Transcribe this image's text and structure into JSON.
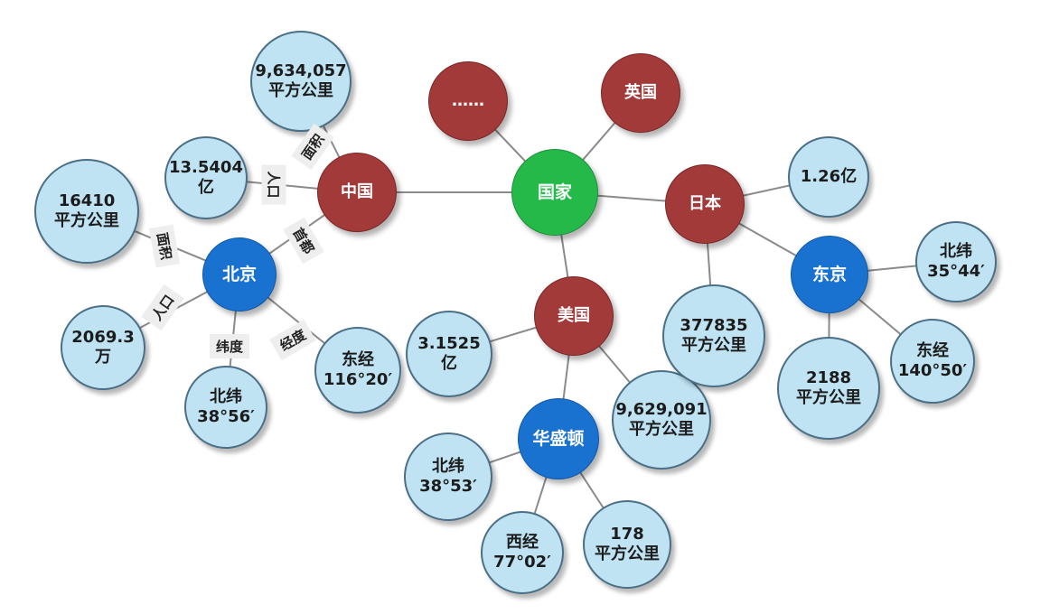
{
  "nodes": {
    "root": {
      "label": "国家",
      "type": "root"
    },
    "more": {
      "label": "……",
      "type": "country"
    },
    "uk": {
      "label": "英国",
      "type": "country"
    },
    "china": {
      "label": "中国",
      "type": "country"
    },
    "japan": {
      "label": "日本",
      "type": "country"
    },
    "usa": {
      "label": "美国",
      "type": "country"
    },
    "beijing": {
      "label": "北京",
      "type": "city"
    },
    "tokyo": {
      "label": "东京",
      "type": "city"
    },
    "washington": {
      "label": "华盛顿",
      "type": "city"
    },
    "china_area": {
      "lines": [
        "9,634,057",
        "平方公里"
      ],
      "type": "info"
    },
    "china_pop": {
      "lines": [
        "13.5404",
        "亿"
      ],
      "type": "info"
    },
    "beijing_area": {
      "lines": [
        "16410",
        "平方公里"
      ],
      "type": "info"
    },
    "beijing_pop": {
      "lines": [
        "2069.3",
        "万"
      ],
      "type": "info"
    },
    "beijing_lat": {
      "lines": [
        "北纬",
        "38°56′"
      ],
      "type": "info"
    },
    "beijing_lon": {
      "lines": [
        "东经",
        "116°20′"
      ],
      "type": "info"
    },
    "usa_pop": {
      "lines": [
        "3.1525",
        "亿"
      ],
      "type": "info"
    },
    "usa_area": {
      "lines": [
        "9,629,091",
        "平方公里"
      ],
      "type": "info"
    },
    "washington_lat": {
      "lines": [
        "北纬",
        "38°53′"
      ],
      "type": "info"
    },
    "washington_lon": {
      "lines": [
        "西经",
        "77°02′"
      ],
      "type": "info"
    },
    "washington_area": {
      "lines": [
        "178",
        "平方公里"
      ],
      "type": "info"
    },
    "japan_pop": {
      "lines": [
        "1.26亿"
      ],
      "type": "info"
    },
    "japan_area": {
      "lines": [
        "377835",
        "平方公里"
      ],
      "type": "info"
    },
    "tokyo_lat": {
      "lines": [
        "北纬",
        "35°44′"
      ],
      "type": "info"
    },
    "tokyo_lon": {
      "lines": [
        "东经",
        "140°50′"
      ],
      "type": "info"
    },
    "tokyo_area": {
      "lines": [
        "2188",
        "平方公里"
      ],
      "type": "info"
    }
  },
  "edges": [
    {
      "from": "root",
      "to": "more"
    },
    {
      "from": "root",
      "to": "uk"
    },
    {
      "from": "root",
      "to": "china"
    },
    {
      "from": "root",
      "to": "japan"
    },
    {
      "from": "root",
      "to": "usa"
    },
    {
      "from": "china",
      "to": "china_area",
      "label": "面积"
    },
    {
      "from": "china",
      "to": "china_pop",
      "label": "人口"
    },
    {
      "from": "china",
      "to": "beijing",
      "label": "首都"
    },
    {
      "from": "beijing",
      "to": "beijing_area",
      "label": "面积"
    },
    {
      "from": "beijing",
      "to": "beijing_pop",
      "label": "人口"
    },
    {
      "from": "beijing",
      "to": "beijing_lat",
      "label": "纬度"
    },
    {
      "from": "beijing",
      "to": "beijing_lon",
      "label": "经度"
    },
    {
      "from": "usa",
      "to": "usa_pop"
    },
    {
      "from": "usa",
      "to": "usa_area"
    },
    {
      "from": "usa",
      "to": "washington"
    },
    {
      "from": "washington",
      "to": "washington_lat"
    },
    {
      "from": "washington",
      "to": "washington_lon"
    },
    {
      "from": "washington",
      "to": "washington_area"
    },
    {
      "from": "japan",
      "to": "japan_pop"
    },
    {
      "from": "japan",
      "to": "japan_area"
    },
    {
      "from": "japan",
      "to": "tokyo"
    },
    {
      "from": "tokyo",
      "to": "tokyo_lat"
    },
    {
      "from": "tokyo",
      "to": "tokyo_lon"
    },
    {
      "from": "tokyo",
      "to": "tokyo_area"
    }
  ]
}
